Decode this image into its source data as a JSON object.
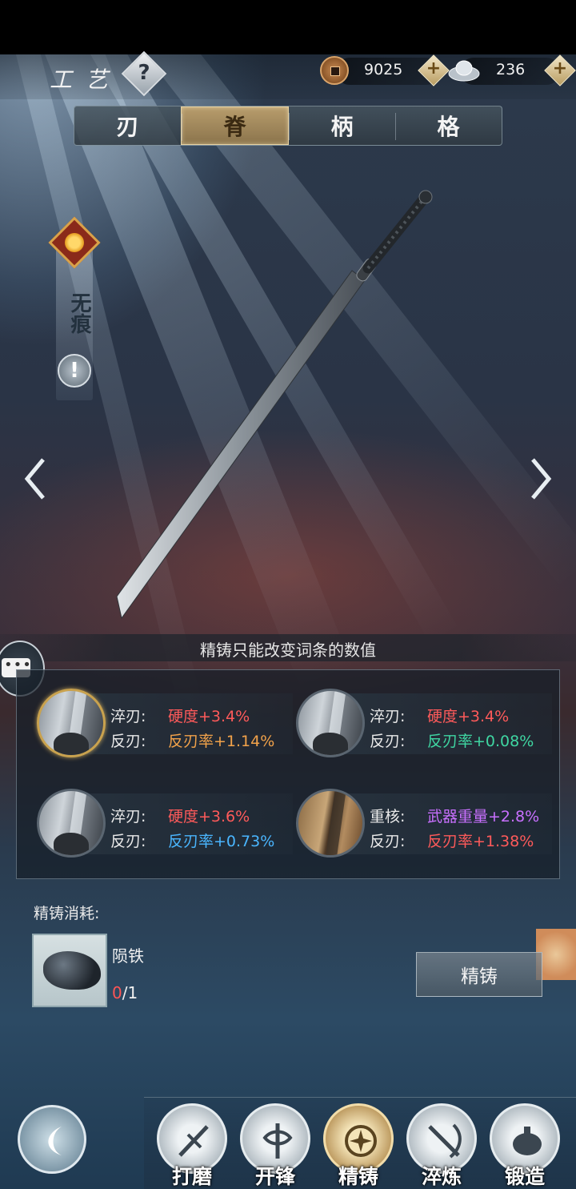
{
  "header": {
    "title": "工 艺",
    "help_label": "?",
    "copper": {
      "value": "9025",
      "plus": "+"
    },
    "silver": {
      "value": "236",
      "plus": "+"
    }
  },
  "tabs": [
    {
      "label": "刃"
    },
    {
      "label": "脊"
    },
    {
      "label": "柄"
    },
    {
      "label": "格"
    }
  ],
  "active_tab": "脊",
  "weapon": {
    "name_vertical": "无痕",
    "warning_label": "!"
  },
  "hint": "精铸只能改变词条的数值",
  "attributes": [
    {
      "line1_label": "淬刃:",
      "line1_value": "硬度+3.4%",
      "line2_label": "反刃:",
      "line2_value": "反刃率+1.14%",
      "selected": true
    },
    {
      "line1_label": "淬刃:",
      "line1_value": "硬度+3.4%",
      "line2_label": "反刃:",
      "line2_value": "反刃率+0.08%",
      "selected": false
    },
    {
      "line1_label": "淬刃:",
      "line1_value": "硬度+3.6%",
      "line2_label": "反刃:",
      "line2_value": "反刃率+0.73%",
      "selected": false
    },
    {
      "line1_label": "重核:",
      "line1_value": "武器重量+2.8%",
      "line2_label": "反刃:",
      "line2_value": "反刃率+1.38%",
      "selected": false
    }
  ],
  "cost": {
    "title": "精铸消耗:",
    "item_name": "陨铁",
    "have": "0",
    "need": "/1"
  },
  "cast_button": "精铸",
  "nav": [
    {
      "label": "打磨",
      "icon": "grind-icon"
    },
    {
      "label": "开锋",
      "icon": "sharpen-icon"
    },
    {
      "label": "精铸",
      "icon": "refine-cast-icon"
    },
    {
      "label": "淬炼",
      "icon": "temper-icon"
    },
    {
      "label": "锻造",
      "icon": "forge-icon"
    }
  ],
  "active_nav": "精铸",
  "colors": {
    "red": "#ff5a5a",
    "orange": "#f2a24a",
    "green": "#3fd6a2",
    "blue": "#4ab6ff",
    "purple": "#c970ff",
    "gold_accent": "#b79c6c"
  }
}
